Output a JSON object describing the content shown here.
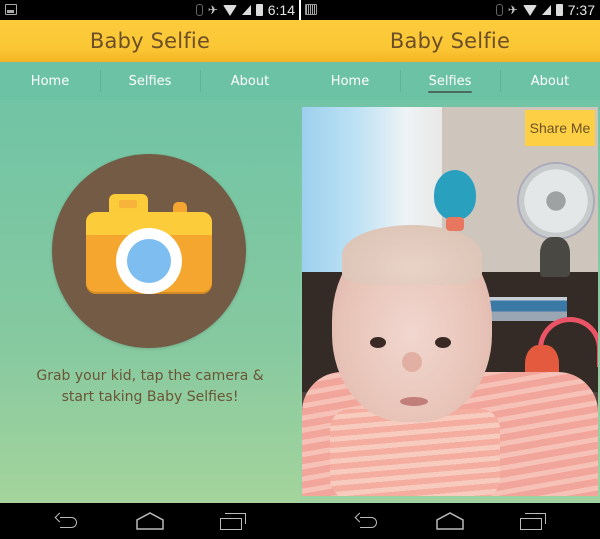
{
  "app": {
    "title": "Baby Selfie"
  },
  "screens": [
    {
      "id": "home",
      "status_bar": {
        "left_icon": "image-notification-icon",
        "icons": [
          "bluetooth-icon",
          "vibrate-icon",
          "wifi-icon",
          "signal-icon",
          "battery-icon"
        ],
        "time": "6:14"
      },
      "header": {
        "title": "Baby Selfie"
      },
      "tabs": [
        {
          "label": "Home",
          "active": false
        },
        {
          "label": "Selfies",
          "active": false
        },
        {
          "label": "About",
          "active": false
        }
      ],
      "main": {
        "camera_button_icon": "camera-icon",
        "tagline_line1": "Grab your kid, tap the camera &",
        "tagline_line2": "start taking Baby Selfies!"
      },
      "system_nav": [
        "back-icon",
        "home-icon",
        "recent-apps-icon"
      ]
    },
    {
      "id": "selfies",
      "status_bar": {
        "left_icon": "notification-icon",
        "icons": [
          "bluetooth-icon",
          "vibrate-icon",
          "wifi-icon",
          "signal-icon",
          "battery-icon"
        ],
        "time": "7:37"
      },
      "header": {
        "title": "Baby Selfie"
      },
      "tabs": [
        {
          "label": "Home",
          "active": false
        },
        {
          "label": "Selfies",
          "active": true
        },
        {
          "label": "About",
          "active": false
        }
      ],
      "main": {
        "photo": "baby-selfie-photo",
        "share_label": "Share Me"
      },
      "system_nav": [
        "back-icon",
        "home-icon",
        "recent-apps-icon"
      ]
    }
  ],
  "colors": {
    "appbar": "#fbc634",
    "title_text": "#6c4f27",
    "navbar": "#6cc2a5",
    "camera_circle": "#735b45",
    "camera_body": "#f5a62e",
    "camera_lens": "#7dbdf0",
    "share_button": "#fdcf45"
  }
}
